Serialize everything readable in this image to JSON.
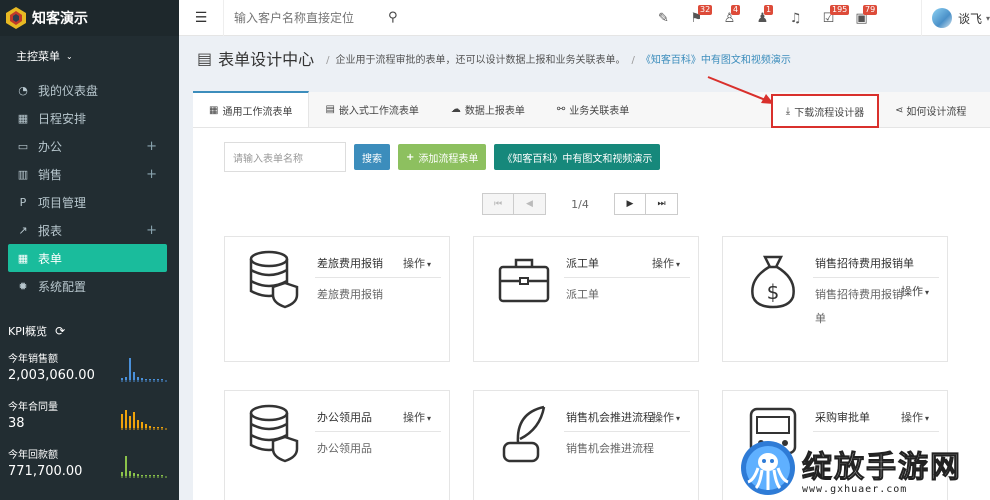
{
  "app": {
    "title": "知客演示"
  },
  "sidebar": {
    "menu_title": "主控菜单",
    "items": [
      {
        "label": "我的仪表盘",
        "icon": "dashboard-icon",
        "glyph": "◔",
        "plus": ""
      },
      {
        "label": "日程安排",
        "icon": "calendar-icon",
        "glyph": "▦",
        "plus": ""
      },
      {
        "label": "办公",
        "icon": "desktop-icon",
        "glyph": "▭",
        "plus": "+"
      },
      {
        "label": "销售",
        "icon": "bar-chart-icon",
        "glyph": "▥",
        "plus": "+"
      },
      {
        "label": "项目管理",
        "icon": "project-icon",
        "glyph": "P",
        "plus": ""
      },
      {
        "label": "报表",
        "icon": "line-chart-icon",
        "glyph": "↗",
        "plus": "+"
      },
      {
        "label": "表单",
        "icon": "table-icon",
        "glyph": "▦",
        "plus": ""
      },
      {
        "label": "系统配置",
        "icon": "gear-icon",
        "glyph": "✹",
        "plus": ""
      }
    ],
    "active_index": 6,
    "kpi_title": "KPI概览",
    "kpis": [
      {
        "label": "今年销售额",
        "value": "2,003,060.00",
        "color": "#4a90d9"
      },
      {
        "label": "今年合同量",
        "value": "38",
        "color": "#f0a30a"
      },
      {
        "label": "今年回款额",
        "value": "771,700.00",
        "color": "#8bc34a"
      }
    ]
  },
  "topbar": {
    "search_placeholder": "输入客户名称直接定位",
    "icons": [
      {
        "name": "magic-wand-icon",
        "glyph": "✎",
        "badge": ""
      },
      {
        "name": "flag-icon",
        "glyph": "⚑",
        "badge": "32"
      },
      {
        "name": "user-lock-icon",
        "glyph": "♙",
        "badge": "4"
      },
      {
        "name": "user-remove-icon",
        "glyph": "♟",
        "badge": "1"
      },
      {
        "name": "bell-icon",
        "glyph": "♫",
        "badge": ""
      },
      {
        "name": "calendar-check-icon",
        "glyph": "☑",
        "badge": "195"
      },
      {
        "name": "briefcase-icon",
        "glyph": "▣",
        "badge": "79"
      }
    ],
    "user_name": "谈飞"
  },
  "page": {
    "title": "表单设计中心",
    "description": "企业用于流程审批的表单，还可以设计数据上报和业务关联表单。",
    "separator": "/",
    "link": "《知客百科》中有图文和视频演示"
  },
  "tabs": [
    {
      "label": "通用工作流表单",
      "icon": "table-icon",
      "glyph": "▦"
    },
    {
      "label": "嵌入式工作流表单",
      "icon": "file-icon",
      "glyph": "▤"
    },
    {
      "label": "数据上报表单",
      "icon": "cloud-upload-icon",
      "glyph": "☁"
    },
    {
      "label": "业务关联表单",
      "icon": "link-icon",
      "glyph": "⚯"
    }
  ],
  "tab_actions": {
    "download": "下载流程设计器",
    "howto": "如何设计流程"
  },
  "toolbar": {
    "search_placeholder": "请输入表单名称",
    "search_button": "搜索",
    "add_button": "添加流程表单",
    "wiki_button": "《知客百科》中有图文和视频演示"
  },
  "pager": {
    "info": "1/4"
  },
  "cards": [
    {
      "title": "差旅费用报销",
      "desc": "差旅费用报销",
      "icon": "database-shield-icon",
      "op": "操作"
    },
    {
      "title": "派工单",
      "desc": "派工单",
      "icon": "briefcase-icon",
      "op": "操作"
    },
    {
      "title": "销售招待费用报销单",
      "desc": "销售招待费用报销单",
      "icon": "money-bag-icon",
      "op": "操作"
    },
    {
      "title": "办公领用品",
      "desc": "办公领用品",
      "icon": "database-shield-icon",
      "op": "操作"
    },
    {
      "title": "销售机会推进流程",
      "desc": "销售机会推进流程",
      "icon": "quill-pen-icon",
      "op": "操作"
    },
    {
      "title": "采购审批单",
      "desc": "",
      "icon": "bus-icon",
      "op": "操作"
    }
  ],
  "watermark": {
    "text": "绽放手游网",
    "url": "www.gxhuaer.com"
  }
}
